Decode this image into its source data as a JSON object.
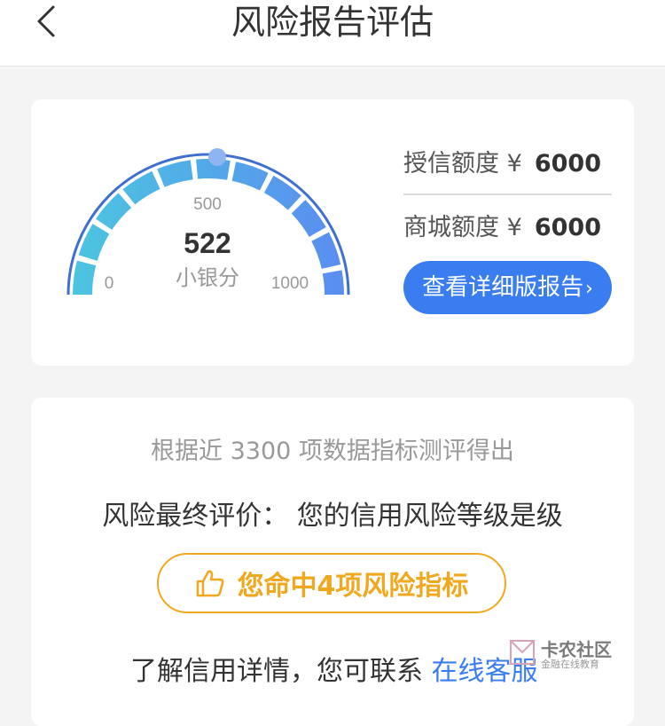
{
  "header": {
    "title": "风险报告评估"
  },
  "score_card": {
    "score": "522",
    "score_label": "小银分",
    "gauge_min": "0",
    "gauge_mid": "500",
    "gauge_max": "1000",
    "credit_limit_label": "授信额度 ¥",
    "credit_limit_value": "6000",
    "mall_limit_label": "商城额度 ¥",
    "mall_limit_value": "6000",
    "report_button_label": "查看详细版报告",
    "report_button_chevron": "›"
  },
  "assessment": {
    "description": "根据近 3300 项数据指标测评得出",
    "final_label": "风险最终评价：",
    "final_value": "您的信用风险等级是级",
    "hit_label": "您命中4项风险指标",
    "contact_text": "了解信用详情，您可联系",
    "contact_link": "在线客服"
  },
  "watermark": {
    "title": "卡农社区",
    "subtitle": "金融在线教育"
  },
  "colors": {
    "accent_blue": "#3a7df0",
    "gauge_teal": "#4cc3e0",
    "warning_orange": "#f0a81e"
  }
}
